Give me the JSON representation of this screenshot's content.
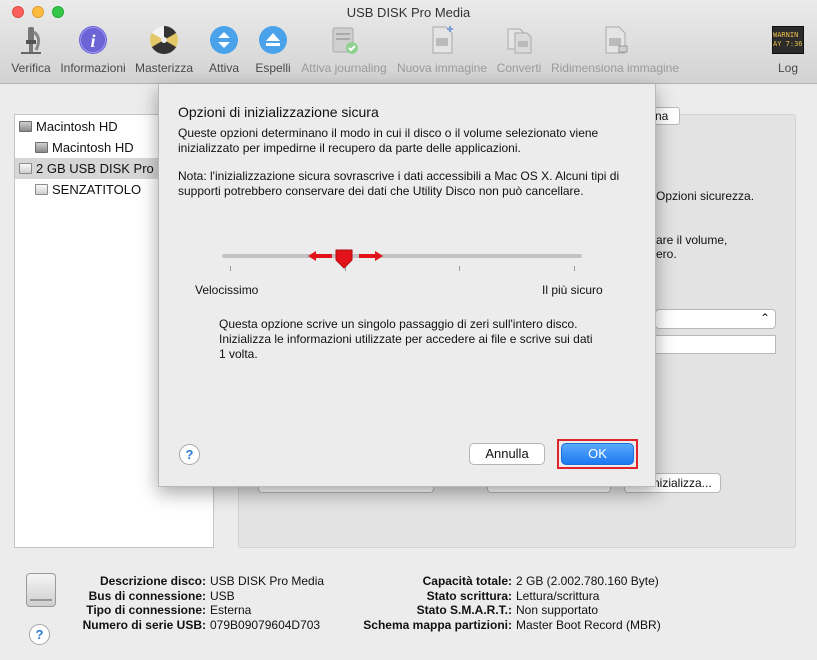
{
  "window": {
    "title": "USB DISK Pro Media"
  },
  "toolbar": [
    {
      "label": "Verifica",
      "icon": "microscope-icon",
      "enabled": true
    },
    {
      "label": "Informazioni",
      "icon": "info-icon",
      "enabled": true
    },
    {
      "label": "Masterizza",
      "icon": "burn-icon",
      "enabled": true
    },
    {
      "label": "Attiva",
      "icon": "mount-icon",
      "enabled": true
    },
    {
      "label": "Espelli",
      "icon": "eject-icon",
      "enabled": true
    },
    {
      "label": "Attiva journaling",
      "icon": "journaling-icon",
      "enabled": false
    },
    {
      "label": "Nuova immagine",
      "icon": "new-image-icon",
      "enabled": false
    },
    {
      "label": "Converti",
      "icon": "convert-icon",
      "enabled": false
    },
    {
      "label": "Ridimensiona immagine",
      "icon": "resize-image-icon",
      "enabled": false
    },
    {
      "label": "Log",
      "icon": "log-icon",
      "enabled": true
    }
  ],
  "log_icon_text": [
    "WARNIN",
    "AY 7:36"
  ],
  "sidebar": {
    "items": [
      {
        "label": "Macintosh HD",
        "selected": false
      },
      {
        "label": "Macintosh HD",
        "selected": false
      },
      {
        "label": "2 GB USB DISK Pro",
        "selected": true
      },
      {
        "label": "SENZATITOLO",
        "selected": false
      }
    ]
  },
  "background_fragments": {
    "tab": "na",
    "line1": "Opzioni sicurezza.",
    "line2": "are il volume,",
    "line3": "ero.",
    "button1": "nizializza..."
  },
  "dialog": {
    "title": "Opzioni di inizializzazione sicura",
    "intro": "Queste opzioni determinano il modo in cui il disco o il volume selezionato viene inizializzato per impedirne il recupero da parte delle applicazioni.",
    "note": "Nota: l'inizializzazione sicura sovrascrive i dati accessibili a Mac OS X. Alcuni tipi di supporti potrebbero conservare dei dati che Utility Disco non può cancellare.",
    "slider": {
      "min_label": "Velocissimo",
      "max_label": "Il più sicuro",
      "position": 0.33,
      "ticks": 4
    },
    "description": "Questa opzione scrive un singolo passaggio di zeri sull'intero disco. Inizializza le informazioni utilizzate per accedere ai file e scrive sui dati 1 volta.",
    "help_label": "?",
    "cancel_label": "Annulla",
    "ok_label": "OK"
  },
  "info": {
    "left": [
      {
        "label": "Descrizione disco:",
        "value": "USB DISK Pro Media"
      },
      {
        "label": "Bus di connessione:",
        "value": "USB"
      },
      {
        "label": "Tipo di connessione:",
        "value": "Esterna"
      },
      {
        "label": "Numero di serie USB:",
        "value": "079B09079604D703"
      }
    ],
    "right": [
      {
        "label": "Capacità totale:",
        "value": "2 GB (2.002.780.160 Byte)"
      },
      {
        "label": "Stato scrittura:",
        "value": "Lettura/scrittura"
      },
      {
        "label": "Stato S.M.A.R.T.:",
        "value": "Non supportato"
      },
      {
        "label": "Schema mappa partizioni:",
        "value": "Master Boot Record (MBR)"
      }
    ]
  },
  "bottom_help_label": "?",
  "colors": {
    "accent": "#1b78f2",
    "highlight_ring": "#e0232a",
    "slider_arrows": "#e2121b"
  }
}
